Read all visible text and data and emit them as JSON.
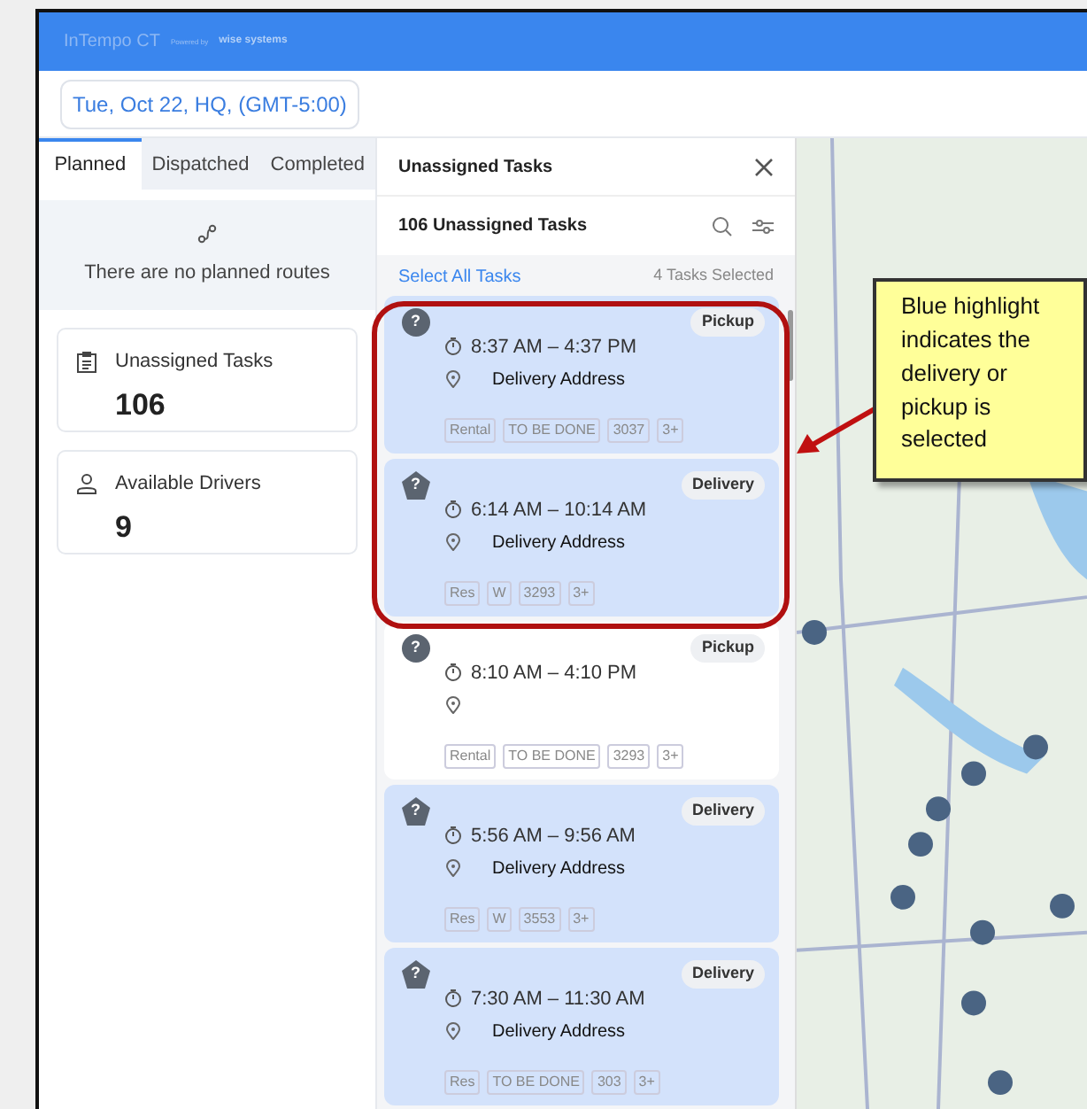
{
  "header": {
    "logo": "InTempo CT",
    "powered_by": "Powered by",
    "brand": "wise systems"
  },
  "date_selector": "Tue, Oct 22, HQ, (GMT-5:00)",
  "route_tabs": [
    {
      "label": "Planned",
      "selected": true
    },
    {
      "label": "Dispatched",
      "selected": false
    },
    {
      "label": "Completed",
      "selected": false
    }
  ],
  "empty_state": "There are no planned routes",
  "summary_cards": [
    {
      "kind": "tasks",
      "label": "Unassigned Tasks",
      "value": "106"
    },
    {
      "kind": "drivers",
      "label": "Available Drivers",
      "value": "9"
    }
  ],
  "task_panel": {
    "title": "Unassigned Tasks",
    "count_label": "106 Unassigned Tasks",
    "select_all": "Select All Tasks",
    "selected_count": "4 Tasks Selected"
  },
  "tasks": [
    {
      "kind": "pickup",
      "mark": "?",
      "type": "Pickup",
      "time": "8:37 AM – 4:37 PM",
      "address": "Delivery Address",
      "tags": [
        "Rental",
        "TO BE DONE",
        "3037",
        "3+"
      ],
      "selected": true
    },
    {
      "kind": "delivery",
      "mark": "?",
      "type": "Delivery",
      "time": "6:14 AM – 10:14 AM",
      "address": "Delivery Address",
      "tags": [
        "Res",
        "W",
        "3293",
        "3+"
      ],
      "selected": true
    },
    {
      "kind": "pickup",
      "mark": "?",
      "type": "Pickup",
      "time": "8:10 AM – 4:10 PM",
      "tags": [
        "Rental",
        "TO BE DONE",
        "3293",
        "3+"
      ],
      "selected": false
    },
    {
      "kind": "delivery",
      "mark": "?",
      "type": "Delivery",
      "time": "5:56 AM – 9:56 AM",
      "address": "Delivery Address",
      "tags": [
        "Res",
        "W",
        "3553",
        "3+"
      ],
      "selected": true
    },
    {
      "kind": "delivery",
      "mark": "?",
      "type": "Delivery",
      "time": "7:30 AM – 11:30 AM",
      "address": "Delivery Address",
      "tags": [
        "Res",
        "TO BE DONE",
        "303",
        "3+"
      ],
      "selected": true
    }
  ],
  "annotation": {
    "callout": "Blue highlight indicates the delivery or pickup is selected"
  }
}
